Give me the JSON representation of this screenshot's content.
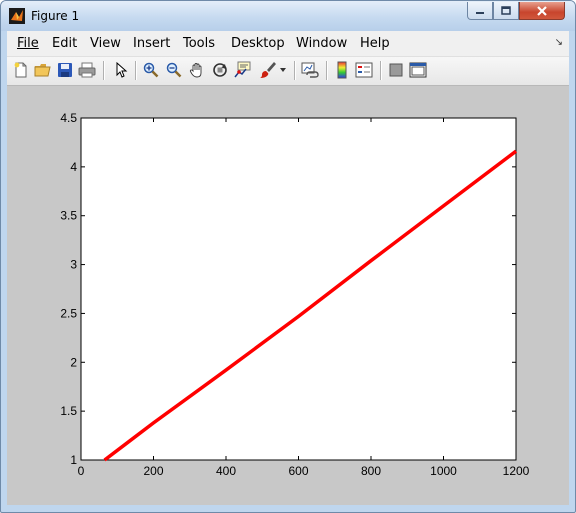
{
  "window": {
    "title": "Figure 1"
  },
  "menu": {
    "file": "File",
    "edit": "Edit",
    "view": "View",
    "insert": "Insert",
    "tools": "Tools",
    "desktop": "Desktop",
    "window": "Window",
    "help": "Help"
  },
  "toolbar_icons": [
    "new-figure-icon",
    "open-file-icon",
    "save-icon",
    "print-icon",
    "edit-plot-pointer-icon",
    "zoom-in-icon",
    "zoom-out-icon",
    "pan-hand-icon",
    "rotate-3d-icon",
    "data-cursor-icon",
    "brush-icon",
    "brush-dropdown-icon",
    "link-plot-icon",
    "colorbar-icon",
    "legend-icon",
    "hide-plot-tools-icon",
    "show-plot-tools-icon"
  ],
  "colors": {
    "line": "#ff0000",
    "figure_bg": "#c8c8c8",
    "axes_bg": "#ffffff"
  },
  "chart_data": {
    "type": "line",
    "title": "",
    "xlabel": "",
    "ylabel": "",
    "xlim": [
      0,
      1200
    ],
    "ylim": [
      1,
      4.5
    ],
    "xticks": [
      0,
      200,
      400,
      600,
      800,
      1000,
      1200
    ],
    "yticks": [
      1,
      1.5,
      2,
      2.5,
      3,
      3.5,
      4,
      4.5
    ],
    "xtick_labels": [
      "0",
      "200",
      "400",
      "600",
      "800",
      "1000",
      "1200"
    ],
    "ytick_labels": [
      "1",
      "1.5",
      "2",
      "2.5",
      "3",
      "3.5",
      "4",
      "4.5"
    ],
    "grid": false,
    "series": [
      {
        "x": [
          65,
          200,
          400,
          600,
          800,
          1000,
          1200
        ],
        "y": [
          1.0,
          1.38,
          1.92,
          2.47,
          3.04,
          3.6,
          4.16
        ],
        "color": "#ff0000"
      }
    ]
  }
}
